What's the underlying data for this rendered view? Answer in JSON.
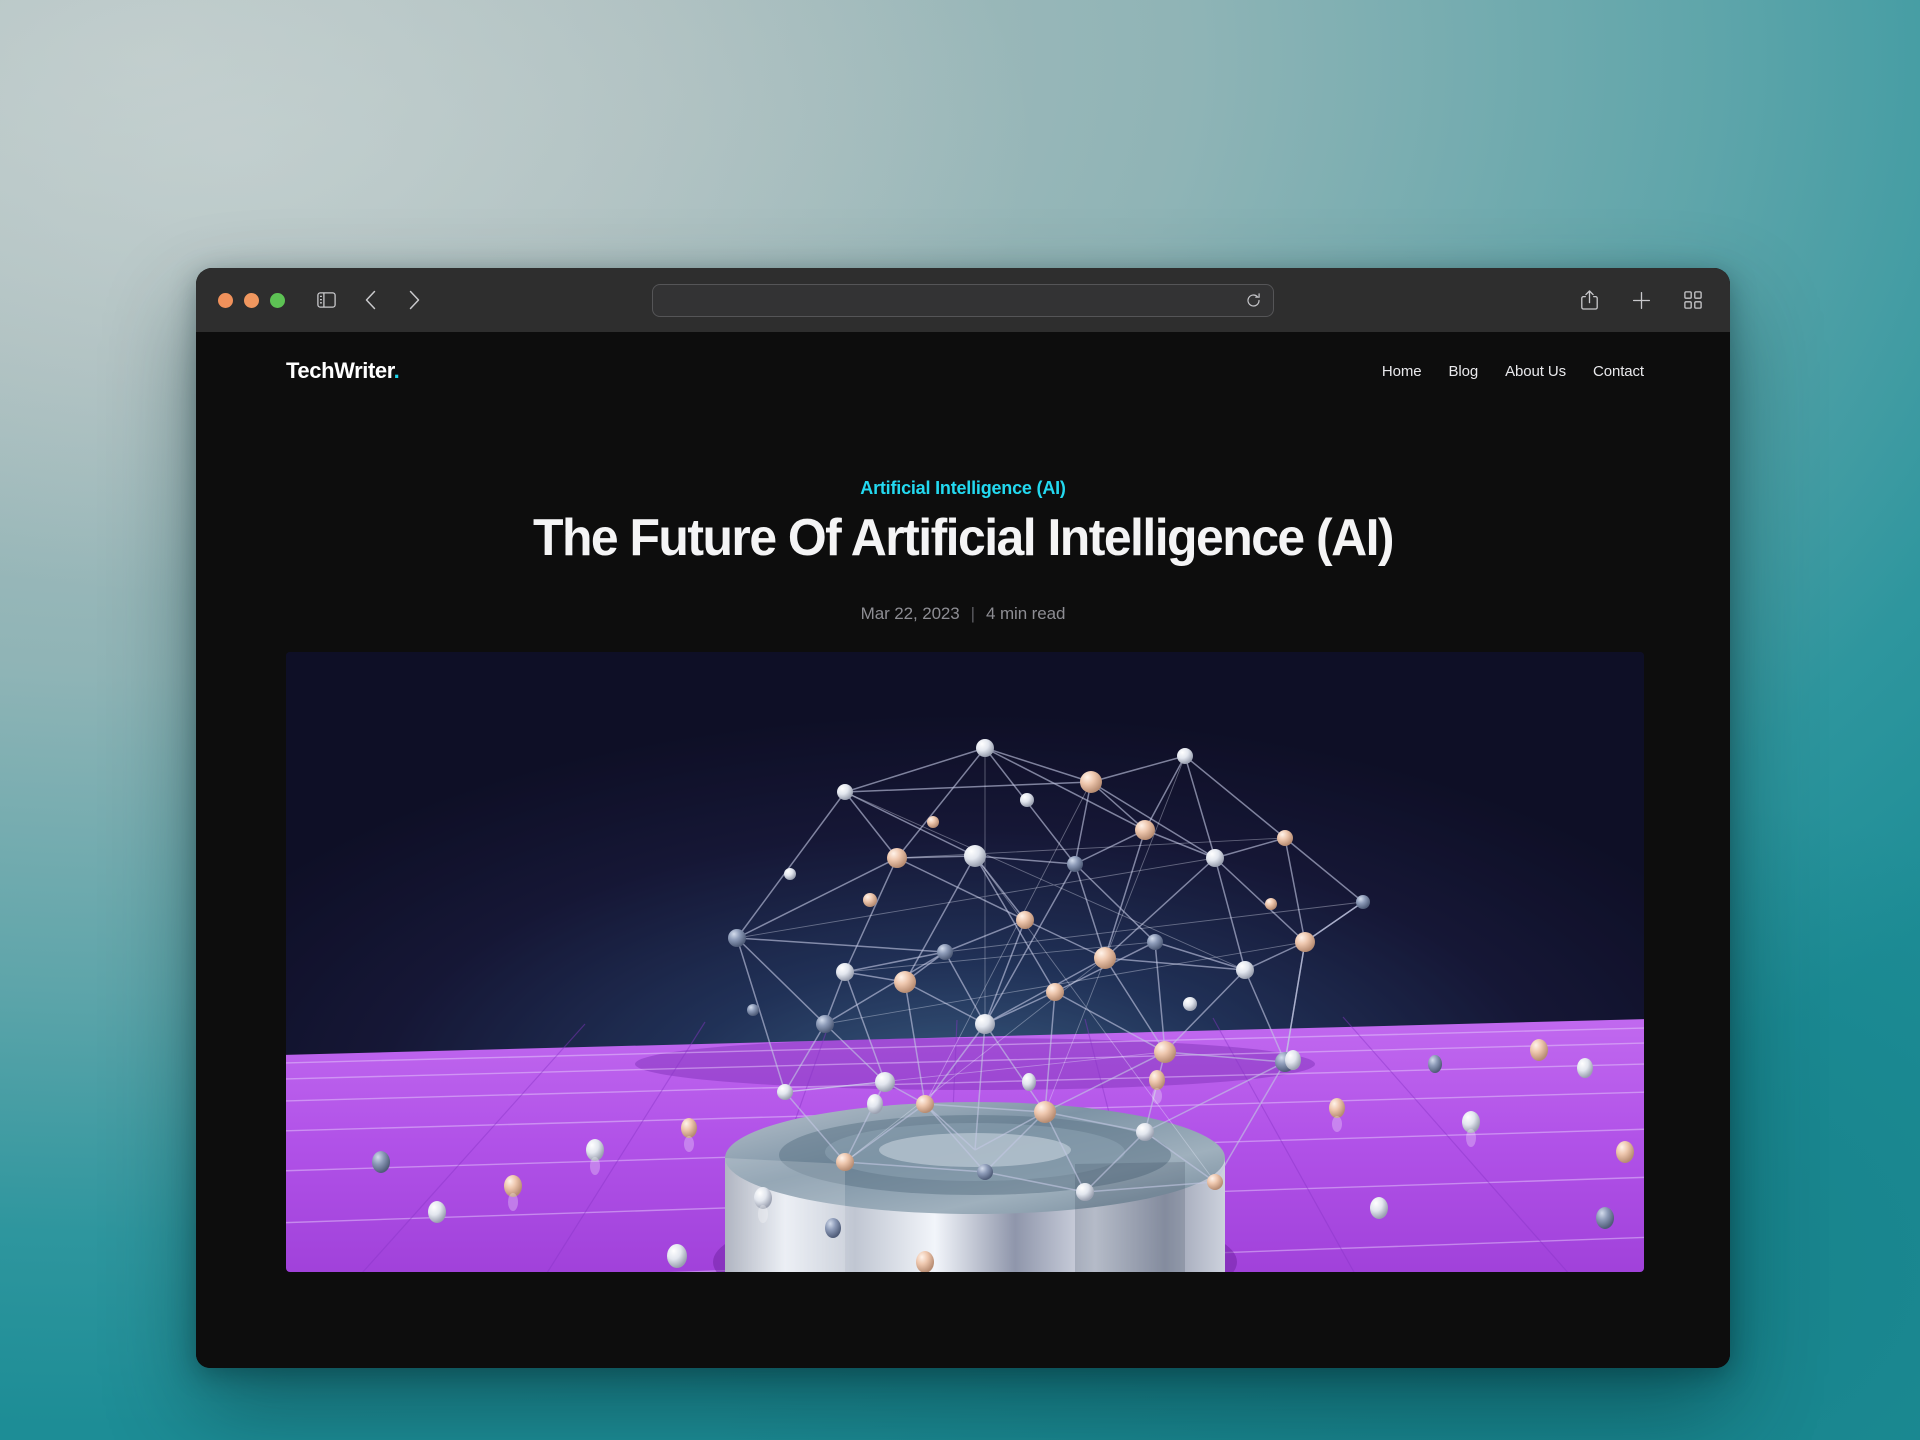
{
  "desktop": {
    "wallpaper_colors": [
      "#b3c3c4",
      "#8fb4b6",
      "#2e969e",
      "#1d8d96"
    ]
  },
  "browser": {
    "window_controls": [
      {
        "name": "close",
        "color": "#f0915b"
      },
      {
        "name": "minimize",
        "color": "#f0975f"
      },
      {
        "name": "zoom",
        "color": "#5dc254"
      }
    ],
    "sidebar_toggle_icon": "sidebar-icon",
    "back_icon": "chevron-left-icon",
    "forward_icon": "chevron-right-icon",
    "address_bar": {
      "value": "",
      "placeholder": "",
      "reload_icon": "reload-icon"
    },
    "actions": [
      {
        "icon": "share-icon"
      },
      {
        "icon": "plus-icon"
      },
      {
        "icon": "tab-overview-icon"
      }
    ]
  },
  "site": {
    "logo_text": "TechWriter",
    "logo_dot": ".",
    "accent_color": "#1fd8ee",
    "nav": [
      {
        "label": "Home"
      },
      {
        "label": "Blog"
      },
      {
        "label": "About Us"
      },
      {
        "label": "Contact"
      }
    ]
  },
  "article": {
    "category": "Artificial Intelligence (AI)",
    "category_color": "#23d9f0",
    "title": "The Future Of Artificial Intelligence (AI)",
    "date": "Mar 22, 2023",
    "separator": "|",
    "read_time": "4 min read",
    "hero_image": {
      "alt": "3D render of a glowing neural network brain made of connected nodes floating above a chrome cylinder on a purple grid plane",
      "background_color": "#141533",
      "plane_color": "#b457e8",
      "node_colors": [
        "#e8c3ae",
        "#f1ece8",
        "#9aa7c4"
      ],
      "strut_color": "#b9bcd8",
      "pedestal_color": "#c9ccd6"
    }
  }
}
